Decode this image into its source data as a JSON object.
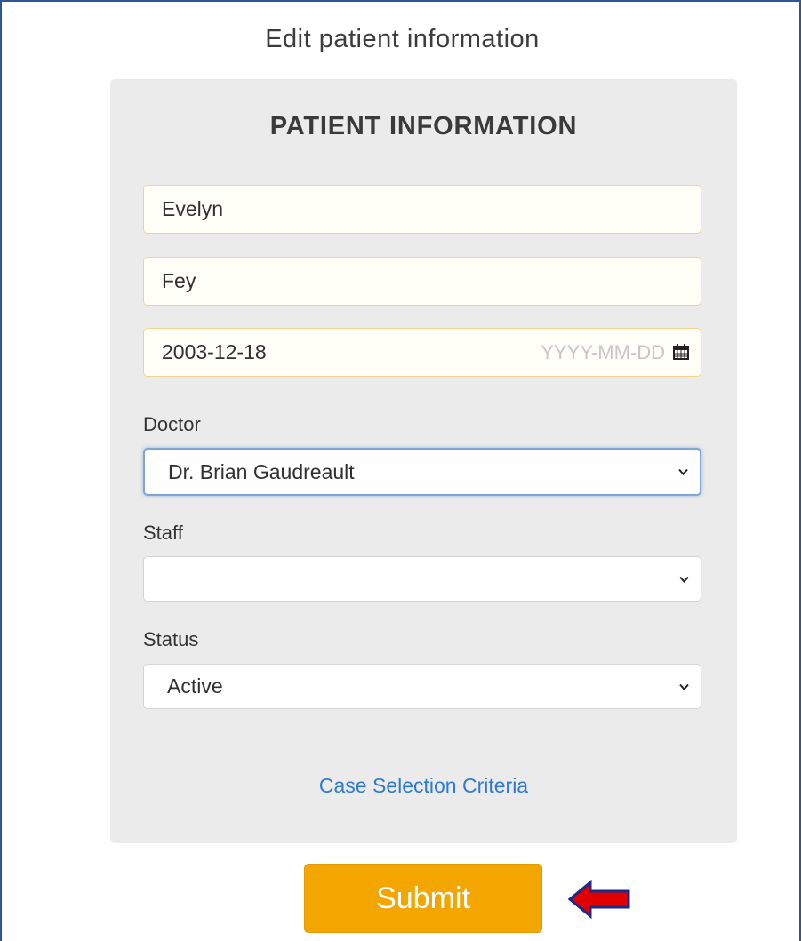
{
  "page": {
    "title": "Edit patient information"
  },
  "form": {
    "heading": "PATIENT INFORMATION",
    "first_name": {
      "value": "Evelyn"
    },
    "last_name": {
      "value": "Fey"
    },
    "birth_date": {
      "value": "2003-12-18",
      "placeholder": "YYYY-MM-DD",
      "icon": "calendar-icon"
    },
    "doctor": {
      "label": "Doctor",
      "selected": "Dr. Brian Gaudreault"
    },
    "staff": {
      "label": "Staff",
      "selected": ""
    },
    "status": {
      "label": "Status",
      "selected": "Active"
    },
    "case_link": "Case Selection Criteria"
  },
  "submit": {
    "label": "Submit"
  },
  "annotation": {
    "icon": "red-arrow-left-icon"
  },
  "colors": {
    "frame_border": "#2f5597",
    "panel_bg": "#ebebeb",
    "field_border": "#f1d38f",
    "link": "#2f7ad0",
    "submit_bg": "#f4a600",
    "arrow_fill": "#e00000",
    "arrow_stroke": "#1a2a8a"
  }
}
